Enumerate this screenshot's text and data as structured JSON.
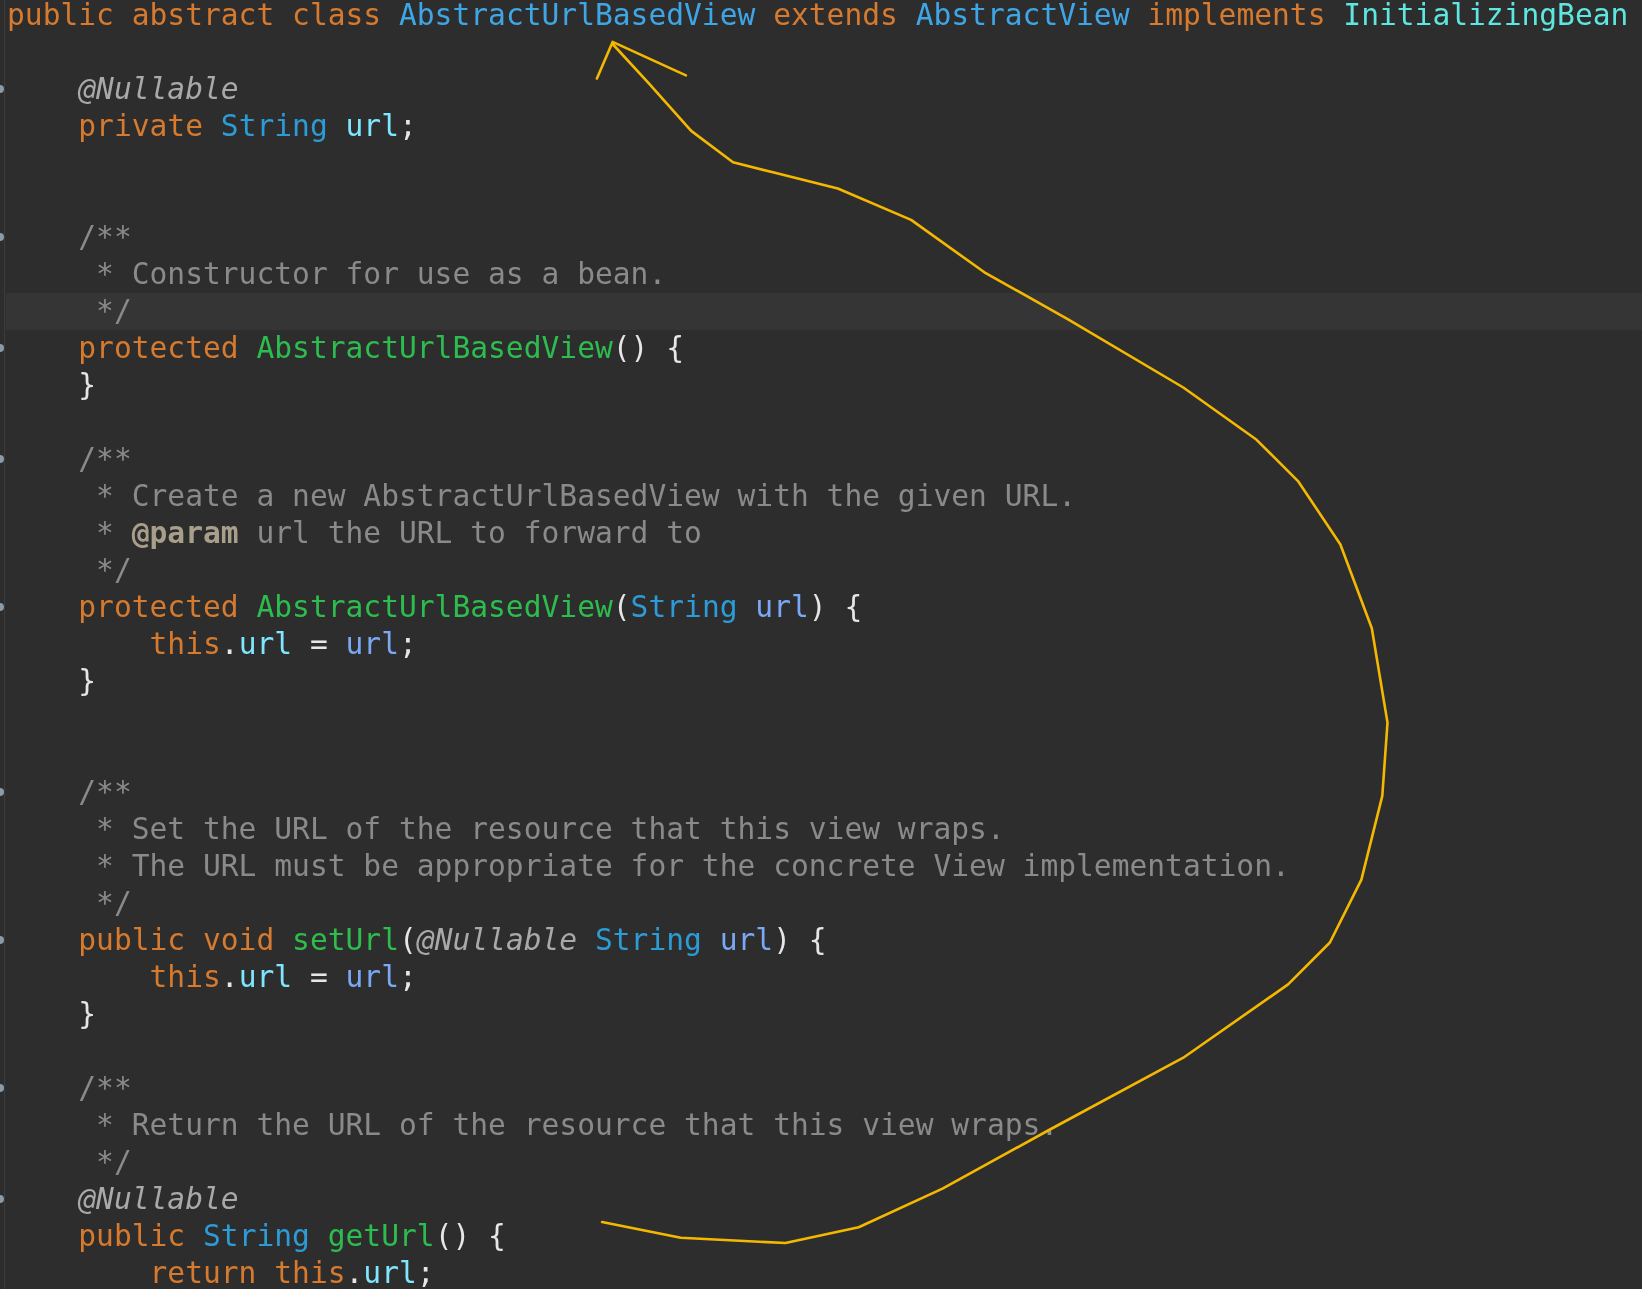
{
  "editor": {
    "lines": [
      {
        "current": false,
        "marker": false,
        "tokens": [
          {
            "kind": "keyword",
            "text": "public abstract class "
          },
          {
            "kind": "classname",
            "text": "AbstractUrlBasedView"
          },
          {
            "kind": "keyword",
            "text": " extends "
          },
          {
            "kind": "classname",
            "text": "AbstractView"
          },
          {
            "kind": "keyword",
            "text": " implements "
          },
          {
            "kind": "interface",
            "text": "InitializingBean"
          }
        ]
      },
      {
        "current": false,
        "marker": false
      },
      {
        "current": false,
        "marker": true,
        "tokens": [
          {
            "kind": "annotation",
            "text": "    @Nullable"
          }
        ]
      },
      {
        "current": false,
        "marker": false,
        "tokens": [
          {
            "kind": "keyword",
            "text": "    private "
          },
          {
            "kind": "type",
            "text": "String "
          },
          {
            "kind": "field",
            "text": "url"
          },
          {
            "kind": "plain",
            "text": ";"
          }
        ]
      },
      {
        "current": false,
        "marker": false
      },
      {
        "current": false,
        "marker": false
      },
      {
        "current": false,
        "marker": true,
        "tokens": [
          {
            "kind": "comment",
            "text": "    /**"
          }
        ]
      },
      {
        "current": false,
        "marker": false,
        "tokens": [
          {
            "kind": "comment",
            "text": "     * Constructor for use as a bean."
          }
        ]
      },
      {
        "current": true,
        "marker": false,
        "tokens": [
          {
            "kind": "comment",
            "text": "     */"
          }
        ]
      },
      {
        "current": false,
        "marker": true,
        "tokens": [
          {
            "kind": "keyword",
            "text": "    protected "
          },
          {
            "kind": "method",
            "text": "AbstractUrlBasedView"
          },
          {
            "kind": "plain",
            "text": "() {"
          }
        ]
      },
      {
        "current": false,
        "marker": false,
        "tokens": [
          {
            "kind": "plain",
            "text": "    }"
          }
        ]
      },
      {
        "current": false,
        "marker": false
      },
      {
        "current": false,
        "marker": true,
        "tokens": [
          {
            "kind": "comment",
            "text": "    /**"
          }
        ]
      },
      {
        "current": false,
        "marker": false,
        "tokens": [
          {
            "kind": "comment",
            "text": "     * Create a new AbstractUrlBasedView with the given URL."
          }
        ]
      },
      {
        "current": false,
        "marker": false,
        "tokens": [
          {
            "kind": "comment",
            "text": "     * "
          },
          {
            "kind": "doctag",
            "text": "@param"
          },
          {
            "kind": "comment",
            "text": " url the URL to forward to"
          }
        ]
      },
      {
        "current": false,
        "marker": false,
        "tokens": [
          {
            "kind": "comment",
            "text": "     */"
          }
        ]
      },
      {
        "current": false,
        "marker": true,
        "tokens": [
          {
            "kind": "keyword",
            "text": "    protected "
          },
          {
            "kind": "method",
            "text": "AbstractUrlBasedView"
          },
          {
            "kind": "plain",
            "text": "("
          },
          {
            "kind": "type",
            "text": "String "
          },
          {
            "kind": "param",
            "text": "url"
          },
          {
            "kind": "plain",
            "text": ") {"
          }
        ]
      },
      {
        "current": false,
        "marker": false,
        "tokens": [
          {
            "kind": "keyword",
            "text": "        this"
          },
          {
            "kind": "plain",
            "text": "."
          },
          {
            "kind": "field",
            "text": "url"
          },
          {
            "kind": "plain",
            "text": " = "
          },
          {
            "kind": "param",
            "text": "url"
          },
          {
            "kind": "plain",
            "text": ";"
          }
        ]
      },
      {
        "current": false,
        "marker": false,
        "tokens": [
          {
            "kind": "plain",
            "text": "    }"
          }
        ]
      },
      {
        "current": false,
        "marker": false
      },
      {
        "current": false,
        "marker": false
      },
      {
        "current": false,
        "marker": true,
        "tokens": [
          {
            "kind": "comment",
            "text": "    /**"
          }
        ]
      },
      {
        "current": false,
        "marker": false,
        "tokens": [
          {
            "kind": "comment",
            "text": "     * Set the URL of the resource that this view wraps."
          }
        ]
      },
      {
        "current": false,
        "marker": false,
        "tokens": [
          {
            "kind": "comment",
            "text": "     * The URL must be appropriate for the concrete View implementation."
          }
        ]
      },
      {
        "current": false,
        "marker": false,
        "tokens": [
          {
            "kind": "comment",
            "text": "     */"
          }
        ]
      },
      {
        "current": false,
        "marker": true,
        "tokens": [
          {
            "kind": "keyword",
            "text": "    public void "
          },
          {
            "kind": "method",
            "text": "setUrl"
          },
          {
            "kind": "plain",
            "text": "("
          },
          {
            "kind": "annotation",
            "text": "@Nullable "
          },
          {
            "kind": "type",
            "text": "String "
          },
          {
            "kind": "param",
            "text": "url"
          },
          {
            "kind": "plain",
            "text": ") {"
          }
        ]
      },
      {
        "current": false,
        "marker": false,
        "tokens": [
          {
            "kind": "keyword",
            "text": "        this"
          },
          {
            "kind": "plain",
            "text": "."
          },
          {
            "kind": "field",
            "text": "url"
          },
          {
            "kind": "plain",
            "text": " = "
          },
          {
            "kind": "param",
            "text": "url"
          },
          {
            "kind": "plain",
            "text": ";"
          }
        ]
      },
      {
        "current": false,
        "marker": false,
        "tokens": [
          {
            "kind": "plain",
            "text": "    }"
          }
        ]
      },
      {
        "current": false,
        "marker": false
      },
      {
        "current": false,
        "marker": true,
        "tokens": [
          {
            "kind": "comment",
            "text": "    /**"
          }
        ]
      },
      {
        "current": false,
        "marker": false,
        "tokens": [
          {
            "kind": "comment",
            "text": "     * Return the URL of the resource that this view wraps."
          }
        ]
      },
      {
        "current": false,
        "marker": false,
        "tokens": [
          {
            "kind": "comment",
            "text": "     */"
          }
        ]
      },
      {
        "current": false,
        "marker": true,
        "tokens": [
          {
            "kind": "annotation",
            "text": "    @Nullable"
          }
        ]
      },
      {
        "current": false,
        "marker": false,
        "tokens": [
          {
            "kind": "keyword",
            "text": "    public "
          },
          {
            "kind": "type",
            "text": "String "
          },
          {
            "kind": "method",
            "text": "getUrl"
          },
          {
            "kind": "plain",
            "text": "() {"
          }
        ]
      },
      {
        "current": false,
        "marker": false,
        "tokens": [
          {
            "kind": "keyword",
            "text": "        return this"
          },
          {
            "kind": "plain",
            "text": "."
          },
          {
            "kind": "field",
            "text": "url"
          },
          {
            "kind": "plain",
            "text": ";"
          }
        ]
      }
    ]
  }
}
